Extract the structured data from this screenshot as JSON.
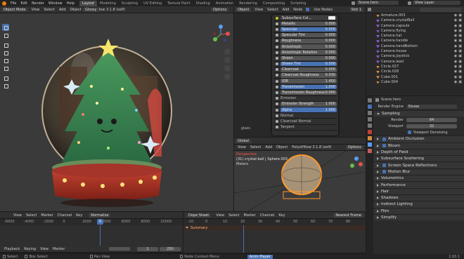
{
  "topbar": {
    "menus": [
      "File",
      "Edit",
      "Render",
      "Window",
      "Help"
    ],
    "workspaces": [
      "Layout",
      "Modeling",
      "Sculpting",
      "UV Editing",
      "Texture Paint",
      "Shading",
      "Animation",
      "Rendering",
      "Compositing",
      "Scripting"
    ],
    "active_workspace": "Layout",
    "scene": "Scene.hero",
    "view_layer": "View Layer"
  },
  "viewport": {
    "mode": "Object Mode",
    "menus": [
      "View",
      "Select",
      "Add",
      "Object"
    ],
    "header_item": "PolyoPillow 3.1.8 (self)",
    "shading": "Glossy",
    "options": "Options"
  },
  "shader": {
    "header": {
      "slot": "Object",
      "menus": [
        "View",
        "Select",
        "Add",
        "Node"
      ],
      "use_nodes": "Use Nodes",
      "slot_name": "Slot 1"
    },
    "top_field": "Subsurface Col...",
    "props": [
      {
        "label": "Metallic",
        "value": "0.000"
      },
      {
        "label": "Specular",
        "value": "0.500",
        "blue": true
      },
      {
        "label": "Specular Tint",
        "value": "0.000"
      },
      {
        "label": "Roughness",
        "value": "0.000"
      },
      {
        "label": "Anisotropic",
        "value": "0.000"
      },
      {
        "label": "Anisotropic Rotation",
        "value": "0.000"
      },
      {
        "label": "Sheen",
        "value": "0.000"
      },
      {
        "label": "Sheen Tint",
        "value": "0.500",
        "blue": true
      },
      {
        "label": "Clearcoat",
        "value": "0.000"
      },
      {
        "label": "Clearcoat Roughness",
        "value": "0.030"
      },
      {
        "label": "IOR",
        "value": "1.450"
      },
      {
        "label": "Transmission",
        "value": "1.000",
        "blue": true
      },
      {
        "label": "Transmission Roughness",
        "value": "0.000"
      },
      {
        "label": "Emission",
        "value": ""
      },
      {
        "label": "Emission Strength",
        "value": "1.000"
      },
      {
        "label": "Alpha",
        "value": "1.000",
        "blue": true
      },
      {
        "label": "Normal",
        "value": ""
      },
      {
        "label": "Clearcoat Normal",
        "value": ""
      },
      {
        "label": "Tangent",
        "value": ""
      }
    ],
    "node_label": "glass"
  },
  "camview": {
    "header": {
      "mode": "Global",
      "menus": [
        "View",
        "Select",
        "Add",
        "Object"
      ],
      "header_item": "PolyoPillow 3.1.8 (self)",
      "options": "Options"
    },
    "title": "Perspective",
    "subtitle": "(31) crystal-ball | Sphere.003",
    "units": "Meters"
  },
  "outliner": {
    "items": [
      {
        "name": "Armature.003",
        "color": "#d38b3d"
      },
      {
        "name": "Camera.crystalBall",
        "color": "#8e5bd6"
      },
      {
        "name": "Camera.capsule",
        "color": "#8e5bd6"
      },
      {
        "name": "Camera.flying",
        "color": "#8e5bd6"
      },
      {
        "name": "Camera.hat",
        "color": "#8e5bd6"
      },
      {
        "name": "Camera.handle",
        "color": "#8e5bd6"
      },
      {
        "name": "Camera.handBottom",
        "color": "#8e5bd6"
      },
      {
        "name": "Camera.house",
        "color": "#8e5bd6"
      },
      {
        "name": "Camera.joystick",
        "color": "#8e5bd6"
      },
      {
        "name": "Camera.lead",
        "color": "#8e5bd6"
      },
      {
        "name": "Circle.027",
        "color": "#d38b3d"
      },
      {
        "name": "Circle.028",
        "color": "#d38b3d"
      },
      {
        "name": "Cube.001",
        "color": "#d38b3d"
      },
      {
        "name": "Cube.004",
        "color": "#d38b3d"
      }
    ]
  },
  "properties": {
    "scene": "Scene.hero",
    "render_engine_label": "Render Engine",
    "render_engine": "Eevee",
    "sampling": "Sampling",
    "render_label": "Render",
    "render_value": "64",
    "viewport_label": "Viewport",
    "viewport_value": "32",
    "denoise": "Viewport Denoising",
    "panels": [
      {
        "label": "Ambient Occlusion",
        "check": true,
        "open": false
      },
      {
        "label": "Bloom",
        "check": true,
        "open": false
      },
      {
        "label": "Depth of Field",
        "check": false,
        "open": false
      },
      {
        "label": "Subsurface Scattering",
        "check": false,
        "open": false
      },
      {
        "label": "Screen Space Reflections",
        "check": true,
        "open": false
      },
      {
        "label": "Motion Blur",
        "check": true,
        "open": false
      },
      {
        "label": "Volumetrics",
        "check": false,
        "open": false
      },
      {
        "label": "Performance",
        "check": false,
        "open": false
      },
      {
        "label": "Hair",
        "check": false,
        "open": false
      },
      {
        "label": "Shadows",
        "check": false,
        "open": false
      },
      {
        "label": "Indirect Lighting",
        "check": false,
        "open": false
      },
      {
        "label": "Film",
        "check": false,
        "open": false
      },
      {
        "label": "Simplify",
        "check": false,
        "open": false
      }
    ]
  },
  "timeline_left": {
    "menus": [
      "View",
      "Select",
      "Marker",
      "Channel",
      "Key"
    ],
    "mode": "Normalize",
    "ruler": [
      "-6000",
      "-4000",
      "-2000",
      "0",
      "2000",
      "4000",
      "6000",
      "8000",
      "10000"
    ],
    "current_frame": "0",
    "bottom": [
      "Playback",
      "Keying",
      "View",
      "Marker"
    ],
    "start": "1",
    "end": "250"
  },
  "timeline_right": {
    "menus": [
      "View",
      "Select",
      "Marker",
      "Channel",
      "Key"
    ],
    "mode": "Dope Sheet",
    "ruler": [
      "-10",
      "0",
      "10",
      "20",
      "30",
      "40",
      "50",
      "60",
      "70",
      "80"
    ],
    "summary": "Summary",
    "nearest_frame": "Nearest Frame"
  },
  "statusbar": {
    "left": "Select",
    "box": "Box Select",
    "pan": "Pan View",
    "center": "Node Context Menu",
    "anim": "Anim Player",
    "version": "2.93.1"
  }
}
